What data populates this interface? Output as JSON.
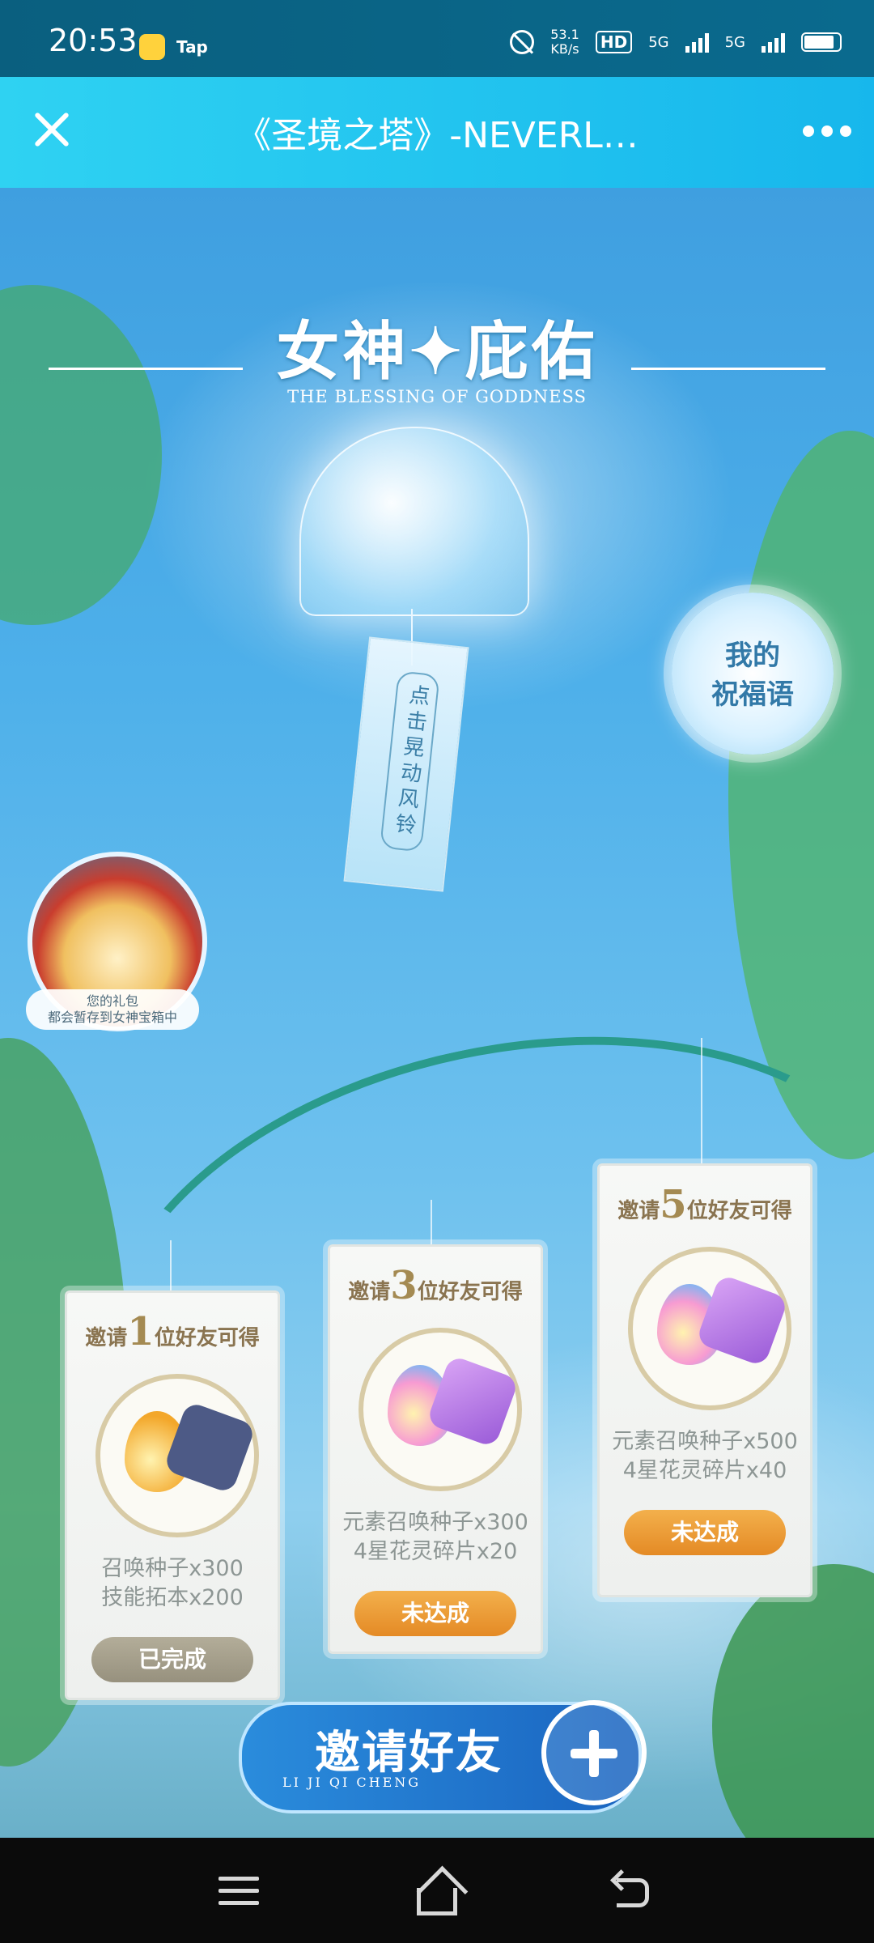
{
  "status_bar": {
    "time": "20:53",
    "app_badge": "Tap",
    "net_speed_value": "53.1",
    "net_speed_unit": "KB/s",
    "hd_label": "HD",
    "sim1": "5G",
    "sim2": "5G"
  },
  "title_bar": {
    "title": "《圣境之塔》-NEVERL…"
  },
  "banner": {
    "title": "女神✦庇佑",
    "subtitle": "THE BLESSING OF GODDNESS"
  },
  "chime": {
    "tag_text": "点击晃动风铃"
  },
  "blessing_button": {
    "line1": "我的",
    "line2": "祝福语"
  },
  "treasure": {
    "line1": "您的礼包",
    "line2": "都会暂存到女神宝箱中"
  },
  "rewards": [
    {
      "prefix": "邀请",
      "count": "1",
      "suffix": "位好友可得",
      "line1": "召唤种子x300",
      "line2": "技能拓本x200",
      "status": "已完成"
    },
    {
      "prefix": "邀请",
      "count": "3",
      "suffix": "位好友可得",
      "line1": "元素召唤种子x300",
      "line2": "4星花灵碎片x20",
      "status": "未达成"
    },
    {
      "prefix": "邀请",
      "count": "5",
      "suffix": "位好友可得",
      "line1": "元素召唤种子x500",
      "line2": "4星花灵碎片x40",
      "status": "未达成"
    }
  ],
  "invite_button": {
    "label": "邀请好友",
    "pinyin": "LI JI QI CHENG"
  },
  "colors": {
    "title_bar": "#1fc3ef",
    "done_button": "#a39d89",
    "todo_button": "#ea9630"
  }
}
